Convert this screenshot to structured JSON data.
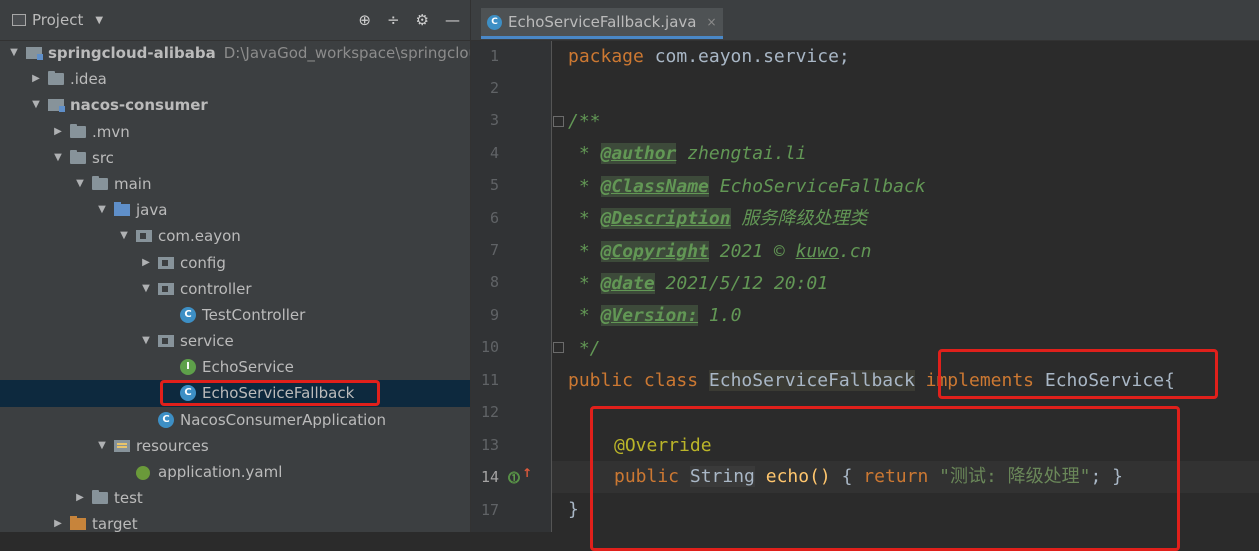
{
  "project_panel": {
    "title": "Project",
    "tools": [
      "⊕",
      "÷",
      "⚙",
      "—"
    ]
  },
  "tree": [
    {
      "label": "springcloud-alibaba",
      "path": "D:\\JavaGod_workspace\\springcloud",
      "level": 0,
      "expanded": true,
      "icon": "module-folder-icon",
      "bold": true
    },
    {
      "label": ".idea",
      "level": 1,
      "expanded": false,
      "icon": "folder-icon"
    },
    {
      "label": "nacos-consumer",
      "level": 1,
      "expanded": true,
      "icon": "module-folder-icon",
      "bold": true
    },
    {
      "label": ".mvn",
      "level": 2,
      "expanded": false,
      "icon": "folder-icon"
    },
    {
      "label": "src",
      "level": 2,
      "expanded": true,
      "icon": "folder-icon"
    },
    {
      "label": "main",
      "level": 3,
      "expanded": true,
      "icon": "folder-icon"
    },
    {
      "label": "java",
      "level": 4,
      "expanded": true,
      "icon": "source-folder-icon"
    },
    {
      "label": "com.eayon",
      "level": 5,
      "expanded": true,
      "icon": "package-icon"
    },
    {
      "label": "config",
      "level": 6,
      "expanded": false,
      "icon": "package-icon"
    },
    {
      "label": "controller",
      "level": 6,
      "expanded": true,
      "icon": "package-icon"
    },
    {
      "label": "TestController",
      "level": 7,
      "icon": "class-icon"
    },
    {
      "label": "service",
      "level": 6,
      "expanded": true,
      "icon": "package-icon"
    },
    {
      "label": "EchoService",
      "level": 7,
      "icon": "interface-icon"
    },
    {
      "label": "EchoServiceFallback",
      "level": 7,
      "icon": "class-icon",
      "selected": true
    },
    {
      "label": "NacosConsumerApplication",
      "level": 6,
      "icon": "spring-boot-class-icon"
    },
    {
      "label": "resources",
      "level": 4,
      "expanded": true,
      "icon": "resources-folder-icon"
    },
    {
      "label": "application.yaml",
      "level": 5,
      "icon": "yaml-file-icon"
    },
    {
      "label": "test",
      "level": 3,
      "expanded": false,
      "icon": "folder-icon"
    },
    {
      "label": "target",
      "level": 2,
      "expanded": false,
      "icon": "target-folder-icon"
    }
  ],
  "editor": {
    "tab_label": "EchoServiceFallback.java",
    "tab_close": "×",
    "line_numbers": [
      "1",
      "2",
      "3",
      "4",
      "5",
      "6",
      "7",
      "8",
      "9",
      "10",
      "11",
      "12",
      "13",
      "14",
      "17"
    ],
    "current_line": "14",
    "lines": {
      "l1_kw": "package",
      "l1_rest": " com.eayon.service;",
      "l3": "/**",
      "l4_star": " * ",
      "l4_tag": "@author",
      "l4_text": " zhengtai.li",
      "l5_star": " * ",
      "l5_tag": "@ClassName",
      "l5_text": " EchoServiceFallback",
      "l6_star": " * ",
      "l6_tag": "@Description",
      "l6_text": " 服务降级处理类",
      "l7_star": " * ",
      "l7_tag": "@Copyright",
      "l7_text_a": " 2021 © ",
      "l7_text_b": "kuwo",
      "l7_text_c": ".cn",
      "l8_star": " * ",
      "l8_tag": "@date",
      "l8_text": " 2021/5/12 20:01",
      "l9_star": " * ",
      "l9_tag": "@Version:",
      "l9_text": " 1.0",
      "l10": " */",
      "l11_kw1": "public class ",
      "l11_name": "EchoServiceFallback",
      "l11_kw2": " implements",
      "l11_rest": " EchoService{",
      "l13_ann": "@Override",
      "l14_kw": "public ",
      "l14_type": "String",
      "l14_method": " echo() ",
      "l14_brace_open": "{ ",
      "l14_return": "return ",
      "l14_str": "\"测试: 降级处理\"",
      "l14_end": "; }",
      "l17": "}"
    }
  }
}
